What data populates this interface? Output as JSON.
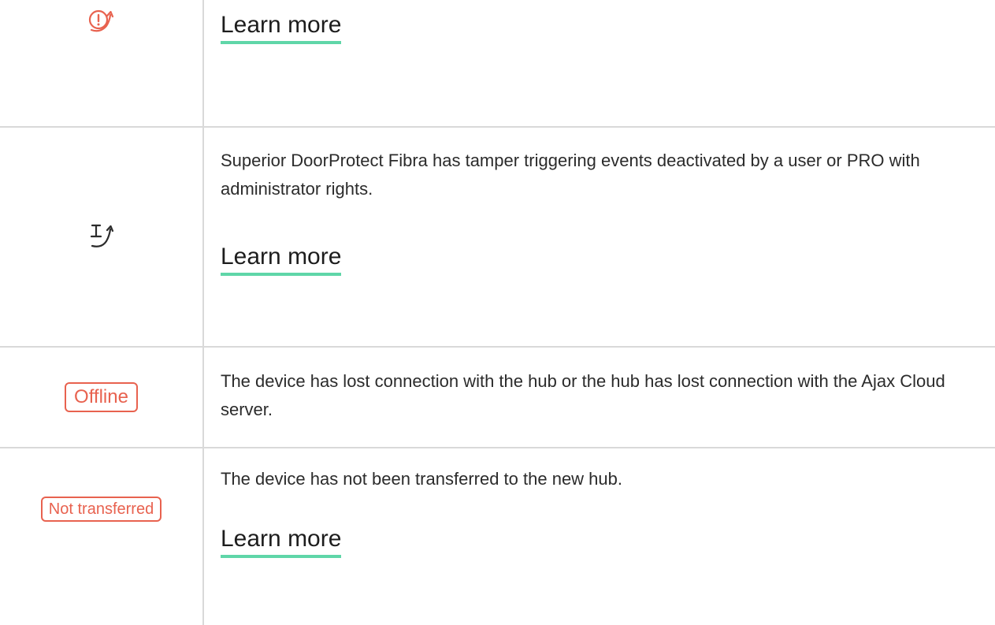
{
  "colors": {
    "accent_red": "#e8624f",
    "link_underline": "#5fd6a8",
    "grid_line": "#d9d9d9",
    "text": "#2b2b2b"
  },
  "rows": [
    {
      "icon": "tamper-alarm-icon",
      "description": "",
      "link": "Learn more"
    },
    {
      "icon": "tamper-deactivated-icon",
      "description": "Superior DoorProtect Fibra has tamper triggering events deactivated by a user or PRO with administrator rights.",
      "link": "Learn more"
    },
    {
      "badge": "Offline",
      "description": "The device has lost connection with the hub or the hub has lost connection with the Ajax Cloud server."
    },
    {
      "badge": "Not transferred",
      "description": "The device has not been transferred to the new hub.",
      "link": "Learn more"
    }
  ]
}
